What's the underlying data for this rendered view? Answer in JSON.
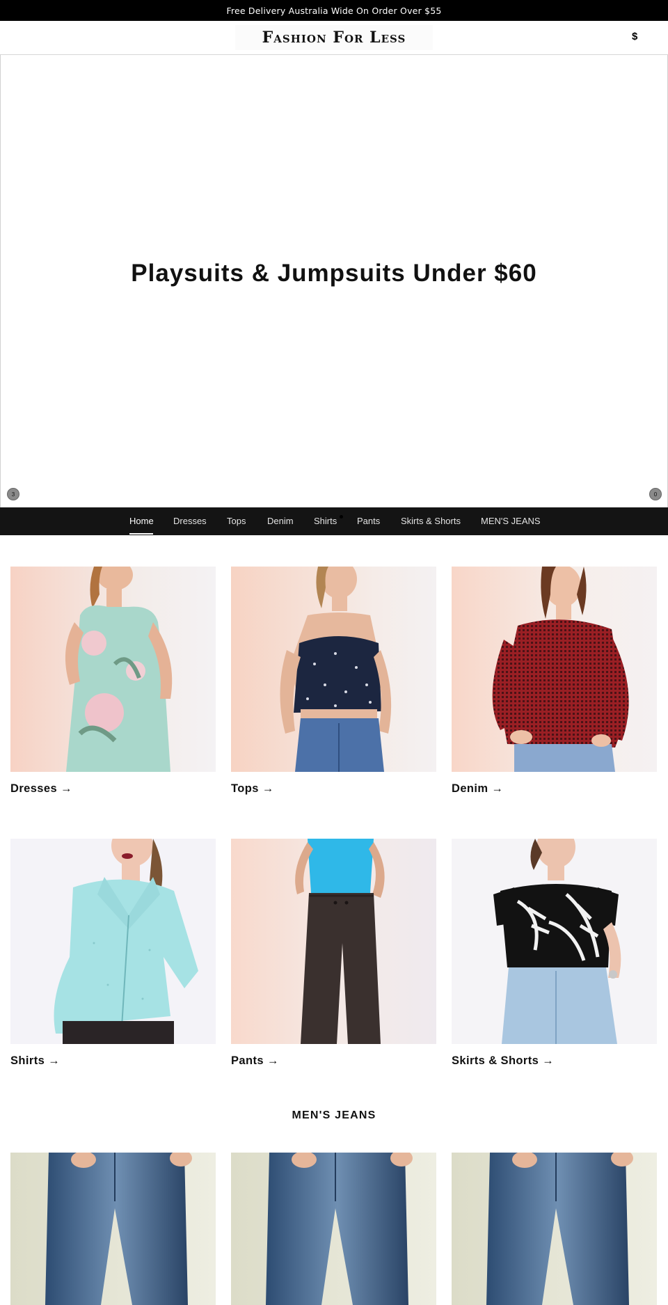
{
  "announcement": {
    "text": "Free Delivery Australia Wide On Order Over $55"
  },
  "header": {
    "logo_text": "Fashion For Less",
    "currency_symbol": "$"
  },
  "hero": {
    "title": "Playsuits & Jumpsuits Under $60",
    "prev_label": "3",
    "next_label": "0"
  },
  "nav": {
    "items": [
      {
        "label": "Home",
        "active": true
      },
      {
        "label": "Dresses"
      },
      {
        "label": "Tops"
      },
      {
        "label": "Denim"
      },
      {
        "label": "Shirts"
      },
      {
        "label": "Pants"
      },
      {
        "label": "Skirts & Shorts"
      },
      {
        "label": "MEN'S JEANS"
      }
    ]
  },
  "collections": [
    {
      "label": "Dresses →",
      "image": "model-in-mint-floral-wrap-dress"
    },
    {
      "label": "Tops →",
      "image": "model-in-navy-polka-dot-crop-top"
    },
    {
      "label": "Denim →",
      "image": "model-in-red-gingham-shirt"
    },
    {
      "label": "Shirts →",
      "image": "model-in-aqua-button-shirt"
    },
    {
      "label": "Pants →",
      "image": "model-in-dark-wide-leg-pants"
    },
    {
      "label": "Skirts & Shorts →",
      "image": "model-in-palm-print-top-and-denim-skirt"
    }
  ],
  "mens_section": {
    "title": "MEN'S JEANS",
    "products": [
      {
        "image": "mens-blue-jeans"
      },
      {
        "image": "mens-blue-jeans"
      },
      {
        "image": "mens-blue-jeans"
      }
    ]
  },
  "colors": {
    "announcement_bg": "#000000",
    "nav_bg": "#141414",
    "text": "#111111"
  }
}
